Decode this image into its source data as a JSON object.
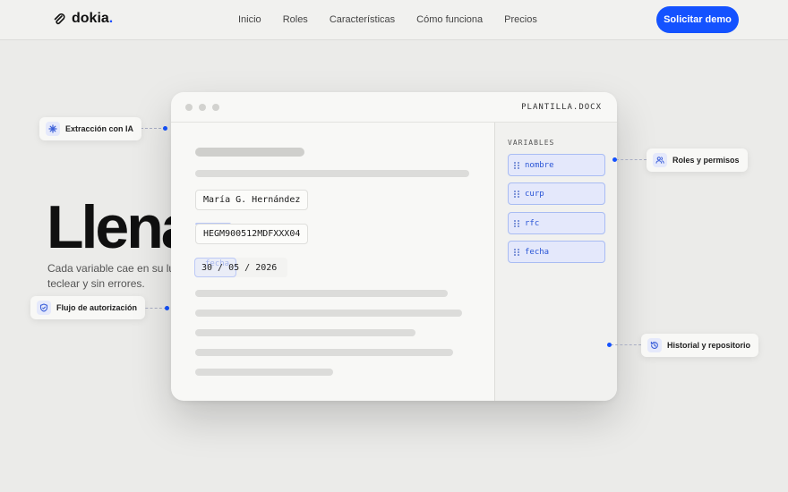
{
  "brand": {
    "name": "dokia",
    "dot": ".",
    "icon": "paperclip-icon",
    "accent": "#1452ff"
  },
  "nav": {
    "links": [
      "Inicio",
      "Roles",
      "Características",
      "Cómo funciona",
      "Precios"
    ],
    "cta": "Solicitar demo"
  },
  "hero": {
    "title_visible": "Llena",
    "subtitle_line1": "Cada variable cae en su lu",
    "subtitle_line2": "teclear y sin errores."
  },
  "chips": {
    "ai": {
      "label": "Extracción con IA",
      "icon": "sparkle-icon"
    },
    "approval": {
      "label": "Flujo de autorización",
      "icon": "shield-check-icon"
    },
    "roles": {
      "label": "Roles y permisos",
      "icon": "users-icon"
    },
    "history": {
      "label": "Historial y repositorio",
      "icon": "history-icon"
    }
  },
  "document": {
    "filename": "PLANTILLA.DOCX",
    "fields": {
      "name": "María G. Hernández",
      "curp": "HEGM900512MDFXXX04",
      "date": "30 / 05 / 2026",
      "date_ghost": "fecha"
    }
  },
  "variables": {
    "title": "VARIABLES",
    "items": [
      "nombre",
      "curp",
      "rfc",
      "fecha"
    ]
  }
}
